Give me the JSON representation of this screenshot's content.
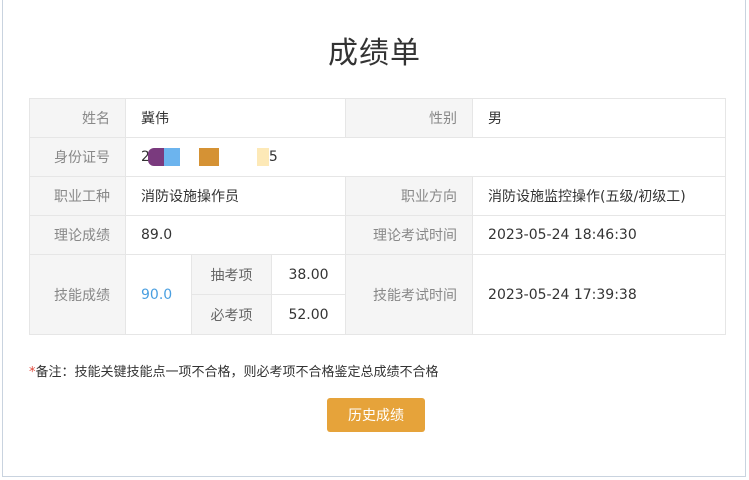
{
  "title": "成绩单",
  "fields": {
    "name_label": "姓名",
    "name_value": "冀伟",
    "gender_label": "性别",
    "gender_value": "男",
    "id_label": "身份证号",
    "id_prefix": "2",
    "id_suffix": "5",
    "occupation_label": "职业工种",
    "occupation_value": "消防设施操作员",
    "direction_label": "职业方向",
    "direction_value": "消防设施监控操作(五级/初级工)",
    "theory_score_label": "理论成绩",
    "theory_score_value": "89.0",
    "theory_time_label": "理论考试时间",
    "theory_time_value": "2023-05-24 18:46:30",
    "skill_score_label": "技能成绩",
    "skill_score_value": "90.0",
    "random_item_label": "抽考项",
    "random_item_value": "38.00",
    "required_item_label": "必考项",
    "required_item_value": "52.00",
    "skill_time_label": "技能考试时间",
    "skill_time_value": "2023-05-24 17:39:38"
  },
  "note": {
    "star": "*",
    "text": "备注：技能关键技能点一项不合格，则必考项不合格鉴定总成绩不合格"
  },
  "history_button": "历史成绩",
  "colors": {
    "accent_button": "#e6a33a",
    "score_blue": "#4a9fe0",
    "required_star": "#e0483a"
  }
}
